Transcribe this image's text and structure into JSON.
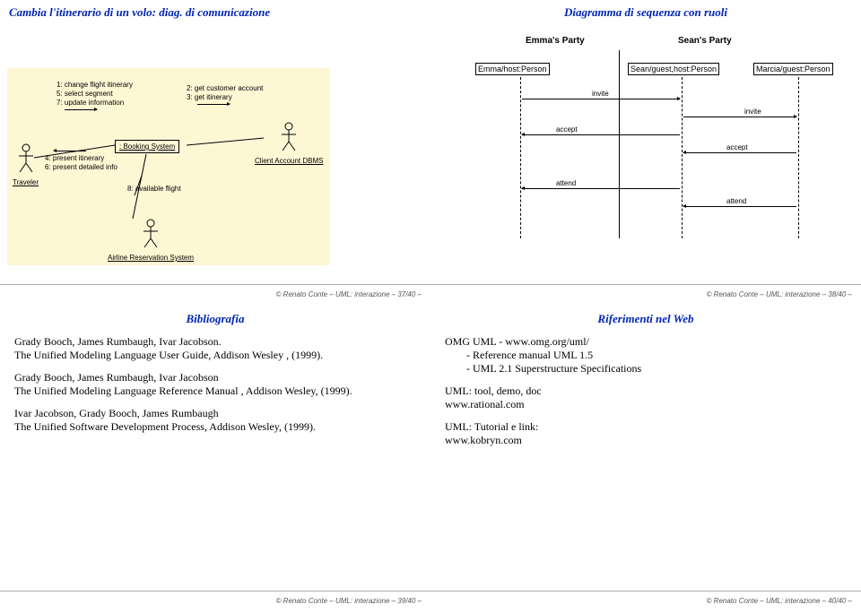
{
  "q1": {
    "title": "Cambia l'itinerario di un volo: diag. di comunicazione",
    "traveler": "Traveler",
    "booking": ": Booking System",
    "client": "Client Account DBMS",
    "airline": "Airline Reservation System",
    "m1": "1: change flight itinerary",
    "m5": "5: select segment",
    "m7": "7: update information",
    "m4": "4: present itinerary",
    "m6": "6: present detailed info",
    "m2": "2: get customer account",
    "m3": "3: get itinerary",
    "m8": "8: available flight",
    "footer": "© Renato Conte – UML: interazione – 37/40 –"
  },
  "q2": {
    "title": "Diagramma di sequenza con ruoli",
    "emma": "Emma's Party",
    "sean": "Sean's Party",
    "a1": "Emma/host:Person",
    "a2": "Sean/guest,host:Person",
    "a3": "Marcia/guest:Person",
    "invite": "invite",
    "accept": "accept",
    "attend": "attend",
    "footer": "© Renato Conte – UML: interazione – 38/40 –"
  },
  "q3": {
    "title": "Bibliografia",
    "b1a": "Grady Booch, James Rumbaugh, Ivar Jacobson.",
    "b1b": "The Unified Modeling Language User Guide, Addison Wesley , (1999).",
    "b2a": "Grady Booch, James Rumbaugh, Ivar Jacobson",
    "b2b": "The Unified Modeling Language Reference Manual , Addison Wesley, (1999).",
    "b3a": "Ivar Jacobson, Grady Booch, James Rumbaugh",
    "b3b": "The Unified Software Development Process, Addison Wesley, (1999).",
    "footer": "© Renato Conte – UML: interazione – 39/40 –"
  },
  "q4": {
    "title": "Riferimenti nel Web",
    "l1": "OMG UML - www.omg.org/uml/",
    "l1a": "- Reference manual UML 1.5",
    "l1b": "- UML 2.1 Superstructure Specifications",
    "l2": "UML: tool, demo, doc",
    "l2a": "www.rational.com",
    "l3": "UML: Tutorial e link:",
    "l3a": "www.kobryn.com",
    "footer": "© Renato Conte – UML: interazione – 40/40 –"
  },
  "chart_data": [
    {
      "type": "communication-diagram",
      "title": "Cambia l'itinerario di un volo: diag. di comunicazione",
      "actors": [
        "Traveler",
        ": Booking System",
        "Client Account DBMS",
        "Airline Reservation System"
      ],
      "messages": [
        {
          "seq": "1",
          "from": "Traveler",
          "to": ": Booking System",
          "label": "change flight itinerary"
        },
        {
          "seq": "2",
          "from": ": Booking System",
          "to": "Client Account DBMS",
          "label": "get customer account"
        },
        {
          "seq": "3",
          "from": ": Booking System",
          "to": "Client Account DBMS",
          "label": "get itinerary"
        },
        {
          "seq": "4",
          "from": ": Booking System",
          "to": "Traveler",
          "label": "present itinerary"
        },
        {
          "seq": "5",
          "from": "Traveler",
          "to": ": Booking System",
          "label": "select segment"
        },
        {
          "seq": "6",
          "from": ": Booking System",
          "to": "Traveler",
          "label": "present detailed info"
        },
        {
          "seq": "7",
          "from": "Traveler",
          "to": ": Booking System",
          "label": "update information"
        },
        {
          "seq": "8",
          "from": ": Booking System",
          "to": "Airline Reservation System",
          "label": "available flight"
        }
      ]
    },
    {
      "type": "sequence-diagram",
      "title": "Diagramma di sequenza con ruoli",
      "partitions": [
        "Emma's Party",
        "Sean's Party"
      ],
      "lifelines": [
        "Emma/host:Person",
        "Sean/guest,host:Person",
        "Marcia/guest:Person"
      ],
      "messages": [
        {
          "from": "Emma/host:Person",
          "to": "Sean/guest,host:Person",
          "label": "invite"
        },
        {
          "from": "Sean/guest,host:Person",
          "to": "Emma/host:Person",
          "label": "accept"
        },
        {
          "from": "Sean/guest,host:Person",
          "to": "Marcia/guest:Person",
          "label": "invite"
        },
        {
          "from": "Marcia/guest:Person",
          "to": "Sean/guest,host:Person",
          "label": "accept"
        },
        {
          "from": "Sean/guest,host:Person",
          "to": "Emma/host:Person",
          "label": "attend"
        },
        {
          "from": "Marcia/guest:Person",
          "to": "Sean/guest,host:Person",
          "label": "attend"
        }
      ]
    }
  ]
}
